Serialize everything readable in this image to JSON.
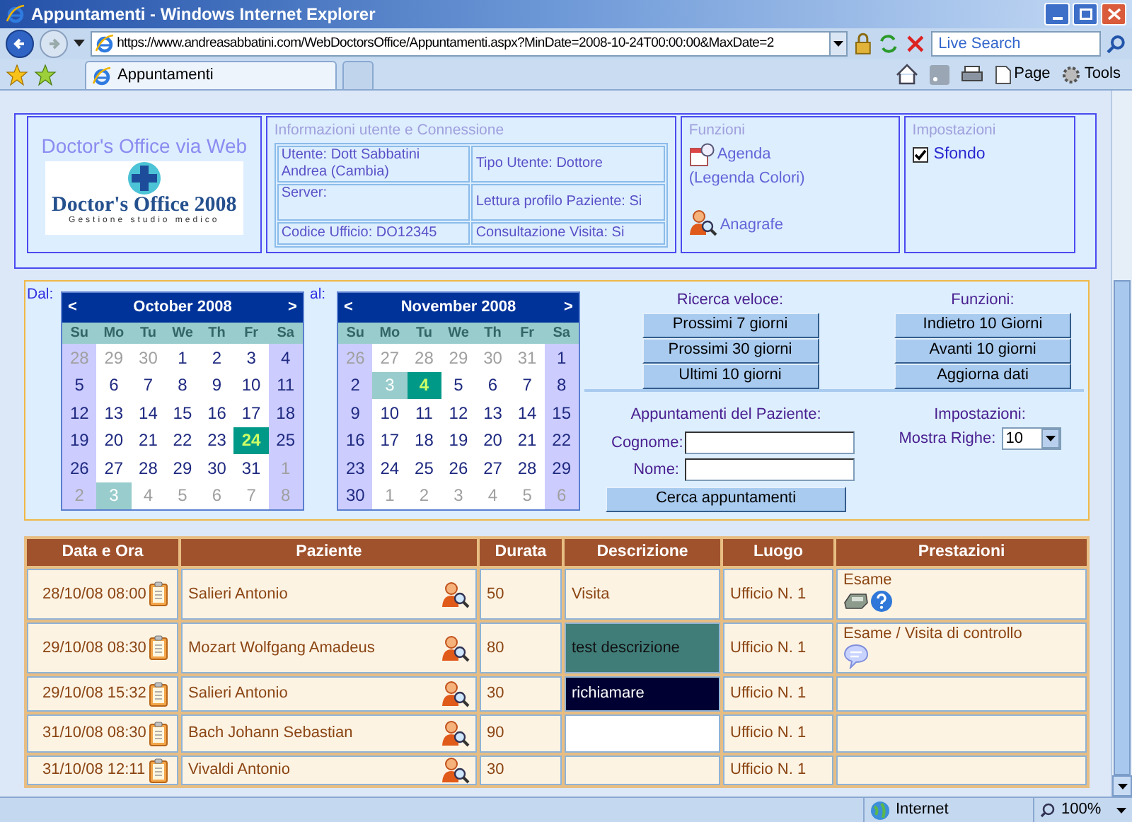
{
  "window": {
    "title": "Appuntamenti - Windows Internet Explorer"
  },
  "address_bar": {
    "url": "https://www.andreasabbatini.com/WebDoctorsOffice/Appuntamenti.aspx?MinDate=2008-10-24T00:00:00&MaxDate=2"
  },
  "search": {
    "placeholder": "Live Search"
  },
  "tabs": [
    {
      "label": "Appuntamenti",
      "selected": true
    }
  ],
  "command_bar": {
    "items": [
      {
        "kind": "page",
        "label": "Page"
      },
      {
        "kind": "tools",
        "label": "Tools"
      }
    ]
  },
  "header": {
    "logo": {
      "title": "Doctor's Office via Web",
      "name": "Doctor's Office 2008",
      "subtitle": "Gestione studio medico"
    },
    "user_info": {
      "heading": "Informazioni utente e Connessione",
      "cells": [
        [
          "Utente: Dott Sabbatini Andrea (Cambia)",
          "Tipo Utente: Dottore"
        ],
        [
          "Server:",
          "Lettura profilo Paziente: Si"
        ],
        [
          "Codice Ufficio: DO12345",
          "Consultazione Visita: Si"
        ]
      ]
    },
    "functions": {
      "heading": "Funzioni",
      "links": [
        {
          "kind": "agenda",
          "label": "Agenda",
          "note": "(Legenda Colori)"
        },
        {
          "kind": "registry",
          "label": "Anagrafe"
        }
      ]
    },
    "settings": {
      "heading": "Impostazioni",
      "options": [
        {
          "label": "Sfondo",
          "checked": true
        }
      ]
    }
  },
  "search_panel": {
    "from_label": "Dal:",
    "to_label": "al:",
    "calendars": [
      {
        "prev": "<",
        "month": "October 2008",
        "next": ">",
        "weekdays": [
          "Su",
          "Mo",
          "Tu",
          "We",
          "Th",
          "Fr",
          "Sa"
        ],
        "weeks": [
          [
            {
              "day": "28",
              "other_month": true,
              "today": false,
              "selected": false
            },
            {
              "day": "29",
              "other_month": true,
              "today": false,
              "selected": false
            },
            {
              "day": "30",
              "other_month": true,
              "today": false,
              "selected": false
            },
            {
              "day": "1",
              "other_month": false,
              "today": false,
              "selected": false
            },
            {
              "day": "2",
              "other_month": false,
              "today": false,
              "selected": false
            },
            {
              "day": "3",
              "other_month": false,
              "today": false,
              "selected": false
            },
            {
              "day": "4",
              "other_month": false,
              "today": false,
              "selected": false
            }
          ],
          [
            {
              "day": "5",
              "other_month": false,
              "today": false,
              "selected": false
            },
            {
              "day": "6",
              "other_month": false,
              "today": false,
              "selected": false
            },
            {
              "day": "7",
              "other_month": false,
              "today": false,
              "selected": false
            },
            {
              "day": "8",
              "other_month": false,
              "today": false,
              "selected": false
            },
            {
              "day": "9",
              "other_month": false,
              "today": false,
              "selected": false
            },
            {
              "day": "10",
              "other_month": false,
              "today": false,
              "selected": false
            },
            {
              "day": "11",
              "other_month": false,
              "today": false,
              "selected": false
            }
          ],
          [
            {
              "day": "12",
              "other_month": false,
              "today": false,
              "selected": false
            },
            {
              "day": "13",
              "other_month": false,
              "today": false,
              "selected": false
            },
            {
              "day": "14",
              "other_month": false,
              "today": false,
              "selected": false
            },
            {
              "day": "15",
              "other_month": false,
              "today": false,
              "selected": false
            },
            {
              "day": "16",
              "other_month": false,
              "today": false,
              "selected": false
            },
            {
              "day": "17",
              "other_month": false,
              "today": false,
              "selected": false
            },
            {
              "day": "18",
              "other_month": false,
              "today": false,
              "selected": false
            }
          ],
          [
            {
              "day": "19",
              "other_month": false,
              "today": false,
              "selected": false
            },
            {
              "day": "20",
              "other_month": false,
              "today": false,
              "selected": false
            },
            {
              "day": "21",
              "other_month": false,
              "today": false,
              "selected": false
            },
            {
              "day": "22",
              "other_month": false,
              "today": false,
              "selected": false
            },
            {
              "day": "23",
              "other_month": false,
              "today": false,
              "selected": false
            },
            {
              "day": "24",
              "other_month": false,
              "today": false,
              "selected": true
            },
            {
              "day": "25",
              "other_month": false,
              "today": false,
              "selected": false
            }
          ],
          [
            {
              "day": "26",
              "other_month": false,
              "today": false,
              "selected": false
            },
            {
              "day": "27",
              "other_month": false,
              "today": false,
              "selected": false
            },
            {
              "day": "28",
              "other_month": false,
              "today": false,
              "selected": false
            },
            {
              "day": "29",
              "other_month": false,
              "today": false,
              "selected": false
            },
            {
              "day": "30",
              "other_month": false,
              "today": false,
              "selected": false
            },
            {
              "day": "31",
              "other_month": false,
              "today": false,
              "selected": false
            },
            {
              "day": "1",
              "other_month": true,
              "today": false,
              "selected": false
            }
          ],
          [
            {
              "day": "2",
              "other_month": true,
              "today": false,
              "selected": false
            },
            {
              "day": "3",
              "other_month": true,
              "today": true,
              "selected": false
            },
            {
              "day": "4",
              "other_month": true,
              "today": false,
              "selected": false
            },
            {
              "day": "5",
              "other_month": true,
              "today": false,
              "selected": false
            },
            {
              "day": "6",
              "other_month": true,
              "today": false,
              "selected": false
            },
            {
              "day": "7",
              "other_month": true,
              "today": false,
              "selected": false
            },
            {
              "day": "8",
              "other_month": true,
              "today": false,
              "selected": false
            }
          ]
        ]
      },
      {
        "prev": "<",
        "month": "November 2008",
        "next": ">",
        "weekdays": [
          "Su",
          "Mo",
          "Tu",
          "We",
          "Th",
          "Fr",
          "Sa"
        ],
        "weeks": [
          [
            {
              "day": "26",
              "other_month": true,
              "today": false,
              "selected": false
            },
            {
              "day": "27",
              "other_month": true,
              "today": false,
              "selected": false
            },
            {
              "day": "28",
              "other_month": true,
              "today": false,
              "selected": false
            },
            {
              "day": "29",
              "other_month": true,
              "today": false,
              "selected": false
            },
            {
              "day": "30",
              "other_month": true,
              "today": false,
              "selected": false
            },
            {
              "day": "31",
              "other_month": true,
              "today": false,
              "selected": false
            },
            {
              "day": "1",
              "other_month": false,
              "today": false,
              "selected": false
            }
          ],
          [
            {
              "day": "2",
              "other_month": false,
              "today": false,
              "selected": false
            },
            {
              "day": "3",
              "other_month": false,
              "today": true,
              "selected": false
            },
            {
              "day": "4",
              "other_month": false,
              "today": false,
              "selected": true
            },
            {
              "day": "5",
              "other_month": false,
              "today": false,
              "selected": false
            },
            {
              "day": "6",
              "other_month": false,
              "today": false,
              "selected": false
            },
            {
              "day": "7",
              "other_month": false,
              "today": false,
              "selected": false
            },
            {
              "day": "8",
              "other_month": false,
              "today": false,
              "selected": false
            }
          ],
          [
            {
              "day": "9",
              "other_month": false,
              "today": false,
              "selected": false
            },
            {
              "day": "10",
              "other_month": false,
              "today": false,
              "selected": false
            },
            {
              "day": "11",
              "other_month": false,
              "today": false,
              "selected": false
            },
            {
              "day": "12",
              "other_month": false,
              "today": false,
              "selected": false
            },
            {
              "day": "13",
              "other_month": false,
              "today": false,
              "selected": false
            },
            {
              "day": "14",
              "other_month": false,
              "today": false,
              "selected": false
            },
            {
              "day": "15",
              "other_month": false,
              "today": false,
              "selected": false
            }
          ],
          [
            {
              "day": "16",
              "other_month": false,
              "today": false,
              "selected": false
            },
            {
              "day": "17",
              "other_month": false,
              "today": false,
              "selected": false
            },
            {
              "day": "18",
              "other_month": false,
              "today": false,
              "selected": false
            },
            {
              "day": "19",
              "other_month": false,
              "today": false,
              "selected": false
            },
            {
              "day": "20",
              "other_month": false,
              "today": false,
              "selected": false
            },
            {
              "day": "21",
              "other_month": false,
              "today": false,
              "selected": false
            },
            {
              "day": "22",
              "other_month": false,
              "today": false,
              "selected": false
            }
          ],
          [
            {
              "day": "23",
              "other_month": false,
              "today": false,
              "selected": false
            },
            {
              "day": "24",
              "other_month": false,
              "today": false,
              "selected": false
            },
            {
              "day": "25",
              "other_month": false,
              "today": false,
              "selected": false
            },
            {
              "day": "26",
              "other_month": false,
              "today": false,
              "selected": false
            },
            {
              "day": "27",
              "other_month": false,
              "today": false,
              "selected": false
            },
            {
              "day": "28",
              "other_month": false,
              "today": false,
              "selected": false
            },
            {
              "day": "29",
              "other_month": false,
              "today": false,
              "selected": false
            }
          ],
          [
            {
              "day": "30",
              "other_month": false,
              "today": false,
              "selected": false
            },
            {
              "day": "1",
              "other_month": true,
              "today": false,
              "selected": false
            },
            {
              "day": "2",
              "other_month": true,
              "today": false,
              "selected": false
            },
            {
              "day": "3",
              "other_month": true,
              "today": false,
              "selected": false
            },
            {
              "day": "4",
              "other_month": true,
              "today": false,
              "selected": false
            },
            {
              "day": "5",
              "other_month": true,
              "today": false,
              "selected": false
            },
            {
              "day": "6",
              "other_month": true,
              "today": false,
              "selected": false
            }
          ]
        ]
      }
    ],
    "quick_search": {
      "heading": "Ricerca veloce:",
      "buttons": [
        "Prossimi 7 giorni",
        "Prossimi 30 giorni",
        "Ultimi 10 giorni"
      ]
    },
    "functions": {
      "heading": "Funzioni:",
      "buttons": [
        "Indietro 10 Giorni",
        "Avanti 10 giorni",
        "Aggiorna dati"
      ]
    },
    "patient_search": {
      "heading": "Appuntamenti del Paziente:",
      "fields": [
        {
          "label": "Cognome:"
        },
        {
          "label": "Nome:"
        }
      ],
      "button": "Cerca appuntamenti"
    },
    "settings": {
      "heading": "Impostazioni:",
      "rows_label": "Mostra Righe:",
      "rows_value": "10"
    }
  },
  "appointments": {
    "columns": [
      "Data e Ora",
      "Paziente",
      "Durata",
      "Descrizione",
      "Luogo",
      "Prestazioni"
    ],
    "rows": [
      {
        "datetime": "28/10/08 08:00",
        "patient": "Salieri Antonio",
        "duration": "50",
        "description": {
          "text": "Visita",
          "color": "#fdf3e3"
        },
        "place": "Ufficio N. 1",
        "services": {
          "text": "Esame",
          "icons": [
            {
              "kind": "device"
            },
            {
              "kind": "help"
            }
          ]
        }
      },
      {
        "datetime": "29/10/08 08:30",
        "patient": "Mozart Wolfgang Amadeus",
        "duration": "80",
        "description": {
          "text": "test descrizione",
          "color": "#407d79"
        },
        "place": "Ufficio N. 1",
        "services": {
          "text": "Esame / Visita di controllo",
          "icons": [
            {
              "kind": "comment"
            }
          ]
        }
      },
      {
        "datetime": "29/10/08 15:32",
        "patient": "Salieri Antonio",
        "duration": "30",
        "description": {
          "text": "richiamare",
          "color": "#000033"
        },
        "place": "Ufficio N. 1"
      },
      {
        "datetime": "31/10/08 08:30",
        "patient": "Bach Johann Sebastian",
        "duration": "90",
        "description": {
          "color": "#ffffff"
        },
        "place": "Ufficio N. 1"
      },
      {
        "datetime": "31/10/08 12:11",
        "patient": "Vivaldi Antonio",
        "duration": "30",
        "place": "Ufficio N. 1"
      }
    ]
  },
  "status_bar": {
    "zone": "Internet",
    "zoom": "100%"
  }
}
